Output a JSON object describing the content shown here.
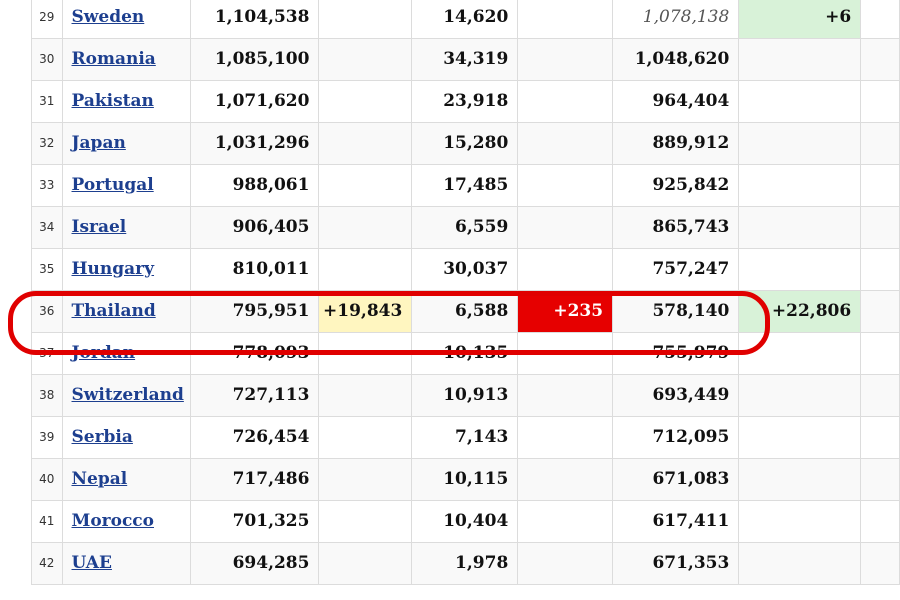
{
  "rows": [
    {
      "rank": "29",
      "country": "Sweden",
      "total_cases": "1,104,538",
      "new_cases": "",
      "total_deaths": "14,620",
      "new_deaths": "",
      "total_recovered": "1,078,138",
      "new_recovered": "+6"
    },
    {
      "rank": "30",
      "country": "Romania",
      "total_cases": "1,085,100",
      "new_cases": "",
      "total_deaths": "34,319",
      "new_deaths": "",
      "total_recovered": "1,048,620",
      "new_recovered": ""
    },
    {
      "rank": "31",
      "country": "Pakistan",
      "total_cases": "1,071,620",
      "new_cases": "",
      "total_deaths": "23,918",
      "new_deaths": "",
      "total_recovered": "964,404",
      "new_recovered": ""
    },
    {
      "rank": "32",
      "country": "Japan",
      "total_cases": "1,031,296",
      "new_cases": "",
      "total_deaths": "15,280",
      "new_deaths": "",
      "total_recovered": "889,912",
      "new_recovered": ""
    },
    {
      "rank": "33",
      "country": "Portugal",
      "total_cases": "988,061",
      "new_cases": "",
      "total_deaths": "17,485",
      "new_deaths": "",
      "total_recovered": "925,842",
      "new_recovered": ""
    },
    {
      "rank": "34",
      "country": "Israel",
      "total_cases": "906,405",
      "new_cases": "",
      "total_deaths": "6,559",
      "new_deaths": "",
      "total_recovered": "865,743",
      "new_recovered": ""
    },
    {
      "rank": "35",
      "country": "Hungary",
      "total_cases": "810,011",
      "new_cases": "",
      "total_deaths": "30,037",
      "new_deaths": "",
      "total_recovered": "757,247",
      "new_recovered": ""
    },
    {
      "rank": "36",
      "country": "Thailand",
      "total_cases": "795,951",
      "new_cases": "+19,843",
      "total_deaths": "6,588",
      "new_deaths": "+235",
      "total_recovered": "578,140",
      "new_recovered": "+22,806"
    },
    {
      "rank": "37",
      "country": "Jordan",
      "total_cases": "778,093",
      "new_cases": "",
      "total_deaths": "10,135",
      "new_deaths": "",
      "total_recovered": "755,979",
      "new_recovered": ""
    },
    {
      "rank": "38",
      "country": "Switzerland",
      "total_cases": "727,113",
      "new_cases": "",
      "total_deaths": "10,913",
      "new_deaths": "",
      "total_recovered": "693,449",
      "new_recovered": ""
    },
    {
      "rank": "39",
      "country": "Serbia",
      "total_cases": "726,454",
      "new_cases": "",
      "total_deaths": "7,143",
      "new_deaths": "",
      "total_recovered": "712,095",
      "new_recovered": ""
    },
    {
      "rank": "40",
      "country": "Nepal",
      "total_cases": "717,486",
      "new_cases": "",
      "total_deaths": "10,115",
      "new_deaths": "",
      "total_recovered": "671,083",
      "new_recovered": ""
    },
    {
      "rank": "41",
      "country": "Morocco",
      "total_cases": "701,325",
      "new_cases": "",
      "total_deaths": "10,404",
      "new_deaths": "",
      "total_recovered": "617,411",
      "new_recovered": ""
    },
    {
      "rank": "42",
      "country": "UAE",
      "total_cases": "694,285",
      "new_cases": "",
      "total_deaths": "1,978",
      "new_deaths": "",
      "total_recovered": "671,353",
      "new_recovered": ""
    }
  ],
  "colors": {
    "new_cases_highlight": "#fff6c0",
    "new_deaths_highlight": "#e60000",
    "new_recovered_highlight": "#d8f2d8",
    "country_link": "#1d3f8f",
    "annotation_circle": "#e00000"
  },
  "annotation": {
    "highlighted_country": "Thailand"
  }
}
